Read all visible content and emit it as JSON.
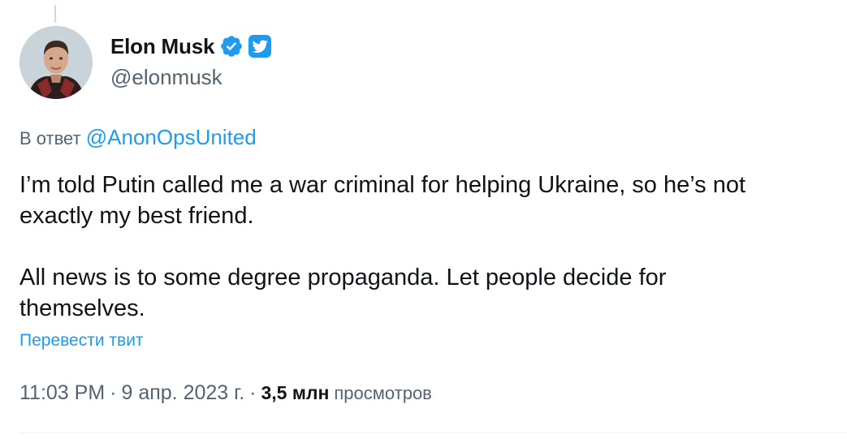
{
  "author": {
    "display_name": "Elon Musk",
    "handle": "@elonmusk",
    "verified_icon": "verified-badge-icon",
    "affiliate_icon": "twitter-bird-icon",
    "accent_color": "#1d9bf0"
  },
  "reply": {
    "prefix": "В ответ",
    "mention": "@AnonOpsUnited"
  },
  "tweet": {
    "text": "I’m told Putin called me a war criminal for helping Ukraine, so he’s not\nexactly my best friend.\n\nAll news is to some degree propaganda. Let people decide for\nthemselves.",
    "translate_label": "Перевести твит"
  },
  "meta": {
    "time": "11:03 PM",
    "separator": "·",
    "date": "9 апр. 2023 г.",
    "views_count": "3,5 млн",
    "views_label": "просмотров"
  }
}
